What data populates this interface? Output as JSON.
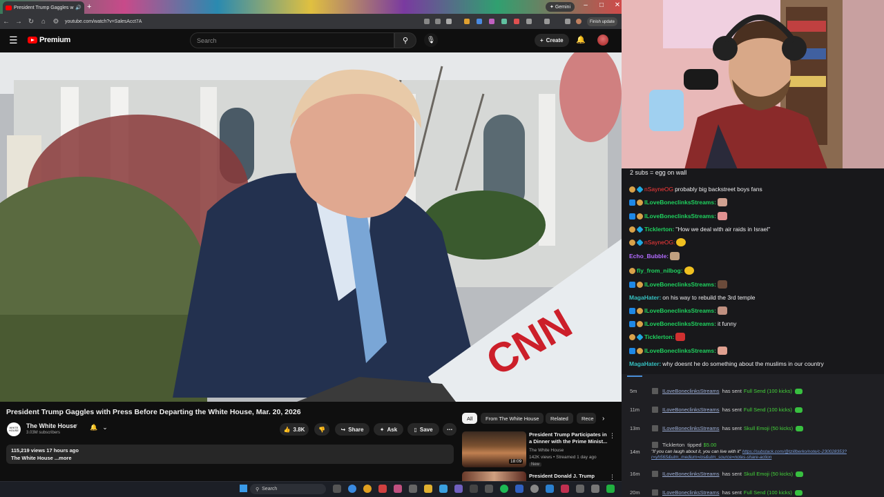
{
  "browser": {
    "tab_title": "President Trump Gaggles w",
    "url": "youtube.com/watch?v=SalesAcct7A",
    "gemini_label": "Gemini",
    "finish_update_label": "Finish update"
  },
  "yt": {
    "logo_text": "Premium",
    "search_placeholder": "Search",
    "create_label": "Create"
  },
  "video": {
    "title": "President Trump Gaggles with Press Before Departing the White House, Mar. 20, 2026",
    "channel_avatar_text": "WHITE HOUSE",
    "channel_name": "The White House",
    "subscribers": "3.03M subscribers",
    "likes": "3.8K",
    "share_label": "Share",
    "ask_label": "Ask",
    "save_label": "Save",
    "views_line": "115,219 views  17 hours ago",
    "description_line": "The White House ...more"
  },
  "chips": [
    "All",
    "From The White House",
    "Related",
    "Rece"
  ],
  "related": [
    {
      "title": "President Trump Participates in a Dinner with the Prime Minist...",
      "channel": "The White House",
      "meta": "142K views • Streamed 1 day ago",
      "badge": "New",
      "duration": "18:09"
    },
    {
      "title": "President Donald J. Trump"
    }
  ],
  "taskbar": {
    "search_label": "Search"
  },
  "chat": {
    "header": "2 subs = egg on wall",
    "lines": [
      {
        "user": "nSayneOG",
        "text": "probably big backstreet boys fans"
      },
      {
        "user": "ILoveBoneclinksStreams:",
        "text": ""
      },
      {
        "user": "ILoveBoneclinksStreams:",
        "text": ""
      },
      {
        "user": "Ticklerton:",
        "text": "\"How we deal with air raids in Israel\""
      },
      {
        "user": "nSayneOG:",
        "text": ""
      },
      {
        "user": "Echo_Bubble:",
        "text": ""
      },
      {
        "user": "fly_from_nilbog:",
        "text": ""
      },
      {
        "user": "ILoveBoneclinksStreams:",
        "text": ""
      },
      {
        "user": "MagaHater:",
        "text": "on his way to rebuild the 3rd temple"
      },
      {
        "user": "ILoveBoneclinksStreams:",
        "text": ""
      },
      {
        "user": "ILoveBoneclinksStreams:",
        "text": "it funny"
      },
      {
        "user": "Ticklerton:",
        "text": ""
      },
      {
        "user": "ILoveBoneclinksStreams:",
        "text": ""
      },
      {
        "user": "MagaHater:",
        "text": "why doesnt he do something about the muslims in our country"
      }
    ]
  },
  "events": [
    {
      "time": "5m",
      "user": "ILoveBoneclinksStreams",
      "action": "has sent",
      "gift": "Full Send (100 kicks)"
    },
    {
      "time": "11m",
      "user": "ILoveBoneclinksStreams",
      "action": "has sent",
      "gift": "Full Send (100 kicks)"
    },
    {
      "time": "13m",
      "user": "ILoveBoneclinksStreams",
      "action": "has sent",
      "gift": "Skull Emoji (50 kicks)"
    },
    {
      "time": "14m",
      "user": "Ticklerton",
      "action": "tipped",
      "gift": "$5.00",
      "note": "\"If you can laugh about it, you can live with it\"",
      "link": "https://substack.com/@tzillberko/note/c-230028353?r=yh56S&utm_medium=ios&utm_source=notes-share-action"
    },
    {
      "time": "16m",
      "user": "ILoveBoneclinksStreams",
      "action": "has sent",
      "gift": "Skull Emoji (50 kicks)"
    },
    {
      "time": "20m",
      "user": "ILoveBoneclinksStreams",
      "action": "has sent",
      "gift": "Full Send (100 kicks)"
    }
  ],
  "colors": {
    "yt_red": "#ff0000",
    "chat_green": "#1fd15e",
    "chat_red": "#ff3b3b",
    "chat_purple": "#b36bff",
    "kick_green": "#44d43a"
  },
  "icons": [
    "menu-icon",
    "search-icon",
    "mic-icon",
    "plus-icon",
    "bell-icon",
    "like-icon",
    "dislike-icon",
    "share-icon",
    "sparkle-icon",
    "save-icon",
    "more-icon",
    "chevron-right-icon"
  ]
}
